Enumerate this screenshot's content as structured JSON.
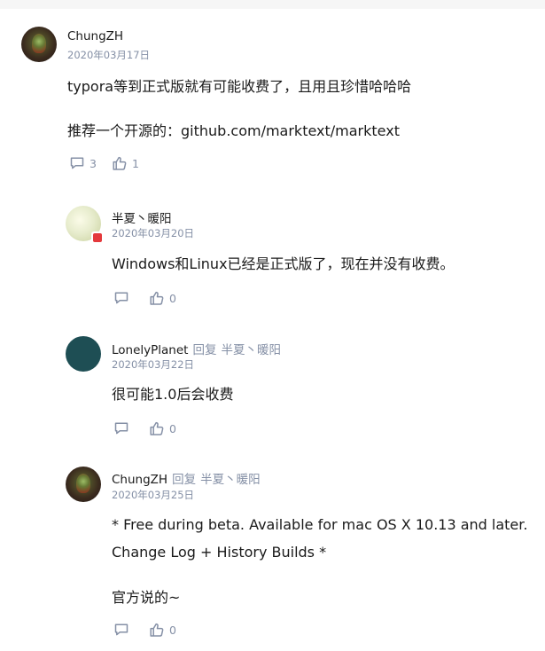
{
  "comments": [
    {
      "author": "ChungZH",
      "date": "2020年03月17日",
      "lines": [
        "typora等到正式版就有可能收费了，且用且珍惜哈哈哈",
        "",
        "推荐一个开源的：github.com/marktext/marktext"
      ],
      "comment_count": "3",
      "like_count": "1"
    },
    {
      "author": "半夏丶暖阳",
      "date": "2020年03月20日",
      "lines": [
        "Windows和Linux已经是正式版了，现在并没有收费。"
      ],
      "like_count": "0"
    },
    {
      "author": "LonelyPlanet",
      "reply_label": "回复",
      "reply_target": "半夏丶暖阳",
      "date": "2020年03月22日",
      "lines": [
        "很可能1.0后会收费"
      ],
      "like_count": "0"
    },
    {
      "author": "ChungZH",
      "reply_label": "回复",
      "reply_target": "半夏丶暖阳",
      "date": "2020年03月25日",
      "lines": [
        "* Free during beta. Available for mac OS X 10.13 and later.",
        "Change Log + History Builds *",
        "",
        "官方说的~"
      ],
      "like_count": "0"
    }
  ],
  "icons": {
    "comment": "comment-icon",
    "like": "thumbs-up-icon"
  },
  "colors": {
    "text": "#1a1a1a",
    "meta": "#8590a6",
    "page_bg": "#f6f6f6",
    "card_bg": "#ffffff",
    "planet_avatar": "#1e4e54",
    "badge_red": "#e4393c"
  }
}
